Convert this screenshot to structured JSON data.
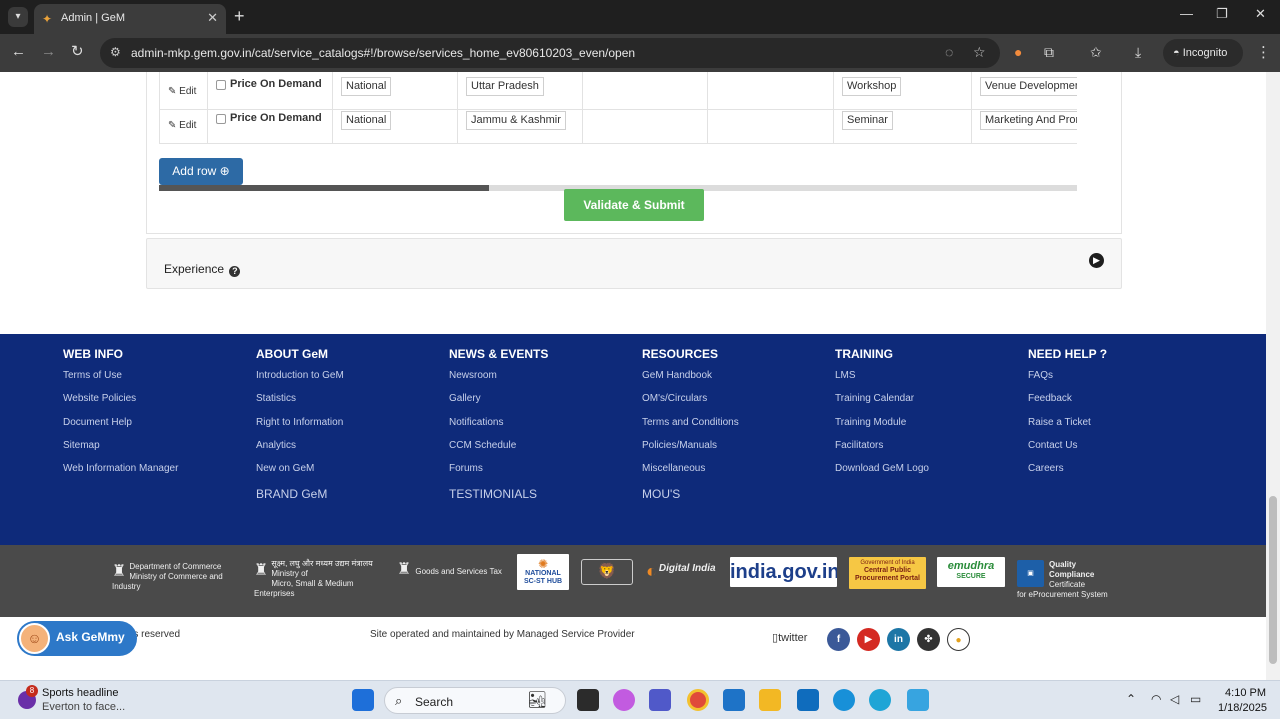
{
  "browser": {
    "tab_title": "Admin | GeM",
    "tab_close": "✕",
    "new_tab": "+",
    "url": "admin-mkp.gem.gov.in/cat/service_catalogs#!/browse/services_home_ev80610203_even/open",
    "incognito_label": "Incognito",
    "window_controls": {
      "minimize": "—",
      "maximize": "❐",
      "close": "✕"
    }
  },
  "table": {
    "rows": [
      {
        "edit_label": "Edit",
        "pricing": "Price On Demand",
        "scope": "National",
        "state": "Uttar Pradesh",
        "category": "Workshop",
        "service": "Venue Development"
      },
      {
        "edit_label": "Edit",
        "pricing": "Price On Demand",
        "scope": "National",
        "state": "Jammu & Kashmir",
        "category": "Seminar",
        "service": "Marketing And Promotion"
      }
    ]
  },
  "actions": {
    "add_row": "Add row",
    "validate_submit": "Validate & Submit",
    "add_row_scroll_fraction": 0.36
  },
  "experience": {
    "title": "Experience",
    "help": "?"
  },
  "footer": {
    "columns": [
      {
        "heading": "WEB INFO",
        "links": [
          "Terms of Use",
          "Website Policies",
          "Document Help",
          "Sitemap",
          "Web Information Manager"
        ],
        "big": ""
      },
      {
        "heading": "ABOUT GeM",
        "links": [
          "Introduction to GeM",
          "Statistics",
          "Right to Information",
          "Analytics",
          "New on GeM"
        ],
        "big": "BRAND GeM"
      },
      {
        "heading": "NEWS & EVENTS",
        "links": [
          "Newsroom",
          "Gallery",
          "Notifications",
          "CCM Schedule",
          "Forums"
        ],
        "big": "TESTIMONIALS"
      },
      {
        "heading": "RESOURCES",
        "links": [
          "GeM Handbook",
          "OM's/Circulars",
          "Terms and Conditions",
          "Policies/Manuals",
          "Miscellaneous"
        ],
        "big": "MOU'S"
      },
      {
        "heading": "TRAINING",
        "links": [
          "LMS",
          "Training Calendar",
          "Training Module",
          "Facilitators",
          "Download GeM Logo"
        ],
        "big": ""
      },
      {
        "heading": "NEED HELP ?",
        "links": [
          "FAQs",
          "Feedback",
          "Raise a Ticket",
          "Contact Us",
          "Careers"
        ],
        "big": ""
      }
    ]
  },
  "partners": {
    "commerce_line1": "Department of Commerce",
    "commerce_line2": "Ministry of Commerce and Industry",
    "msme_line1": "सूक्ष्म, लघु और मध्यम उद्यम मंत्रालय",
    "msme_line2": "Ministry of",
    "msme_line3": "Micro, Small & Medium Enterprises",
    "gst": "Goods and Services Tax",
    "scst_line1": "NATIONAL",
    "scst_line2": "SC-ST HUB",
    "digital_india": "Digital India",
    "india_gov": "india.gov.in",
    "cppp_line1": "Government of India",
    "cppp_line2": "Central Public",
    "cppp_line3": "Procurement Portal",
    "emudhra": "emudhra",
    "emudhra_secure": "SECURE",
    "stqc_line1": "Quality Compliance",
    "stqc_line2": "Certificate",
    "stqc_line3": "for eProcurement System"
  },
  "bottom": {
    "copyright": "nts reserved",
    "operated": "Site operated and maintained by Managed Service Provider",
    "twitter_alt": "twitter",
    "ask_label": "Ask GeMmy"
  },
  "taskbar": {
    "news_badge": "8",
    "news_title": "Sports headline",
    "news_sub": "Everton to face...",
    "search_placeholder": "Search",
    "time": "4:10 PM",
    "date": "1/18/2025"
  },
  "colors": {
    "footer_bg": "#0e2a7a",
    "add_row_bg": "#2d6aa5",
    "submit_bg": "#5cb85c",
    "partners_bg": "#4a4a4a"
  }
}
